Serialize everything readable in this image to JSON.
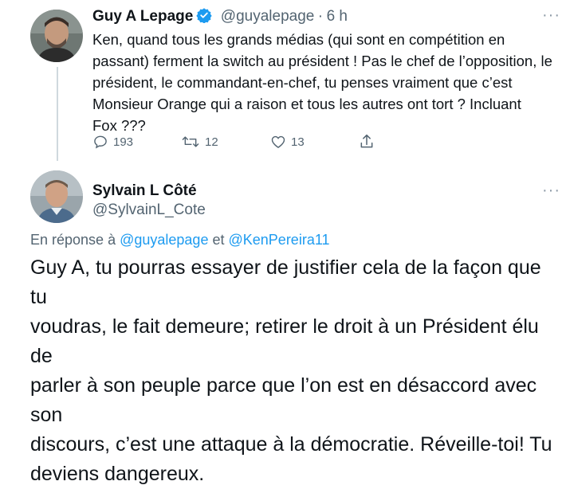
{
  "tweet1": {
    "author_name": "Guy A Lepage",
    "handle": "@guyalepage",
    "separator": "·",
    "time": "6 h",
    "text_lines": [
      "Ken, quand tous les grands médias (qui sont en compétition en",
      "passant) ferment la switch au président ! Pas le chef de l’opposition, le",
      "président, le commandant-en-chef, tu penses vraiment que c’est",
      "Monsieur Orange qui a raison et tous les autres ont tort ? Incluant",
      "Fox ???"
    ],
    "replies": "193",
    "retweets": "12",
    "likes": "13",
    "more": "···"
  },
  "tweet2": {
    "author_name": "Sylvain L Côté",
    "handle": "@SylvainL_Cote",
    "more": "···",
    "reply_prefix": "En réponse à",
    "reply_user1": "@guyalepage",
    "reply_and": "et",
    "reply_user2": "@KenPereira11",
    "text_lines": [
      "Guy A, tu pourras essayer de justifier cela de la façon que tu",
      "voudras, le fait demeure; retirer le droit à un Président élu de",
      "parler à son peuple parce que l’on est en désaccord avec son",
      "discours, c’est une attaque à la démocratie. Réveille-toi! Tu",
      "deviens dangereux."
    ]
  },
  "colors": {
    "accent": "#1d9bf0",
    "muted": "#536471",
    "text": "#0f1419"
  }
}
